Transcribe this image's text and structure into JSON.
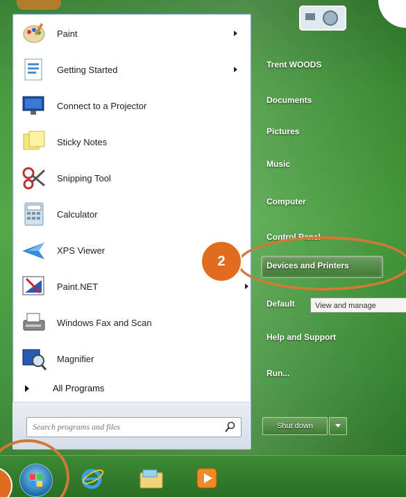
{
  "programs": [
    {
      "label": "Paint",
      "icon": "paint-icon",
      "has_submenu": true
    },
    {
      "label": "Getting Started",
      "icon": "getting-started-icon",
      "has_submenu": true
    },
    {
      "label": "Connect to a Projector",
      "icon": "projector-icon",
      "has_submenu": false
    },
    {
      "label": "Sticky Notes",
      "icon": "sticky-notes-icon",
      "has_submenu": false
    },
    {
      "label": "Snipping Tool",
      "icon": "scissors-icon",
      "has_submenu": false
    },
    {
      "label": "Calculator",
      "icon": "calculator-icon",
      "has_submenu": false
    },
    {
      "label": "XPS Viewer",
      "icon": "xps-viewer-icon",
      "has_submenu": false
    },
    {
      "label": "Paint.NET",
      "icon": "paint-net-icon",
      "has_submenu": true
    },
    {
      "label": "Windows Fax and Scan",
      "icon": "fax-scan-icon",
      "has_submenu": false
    },
    {
      "label": "Magnifier",
      "icon": "magnifier-icon",
      "has_submenu": false
    }
  ],
  "all_programs": "All Programs",
  "search": {
    "placeholder": "Search programs and files"
  },
  "right_items": {
    "user": "Trent WOODS",
    "documents": "Documents",
    "pictures": "Pictures",
    "music": "Music",
    "computer": "Computer",
    "control_panel": "Control Panel",
    "devices_printers": "Devices and Printers",
    "default_programs": "Default",
    "help": "Help and Support",
    "run": "Run..."
  },
  "tooltip": "View and manage",
  "shutdown": {
    "label": "Shut down"
  },
  "callouts": {
    "step2": "2"
  },
  "colors": {
    "accent": "#e06d1f",
    "glass": "#3f9436"
  }
}
